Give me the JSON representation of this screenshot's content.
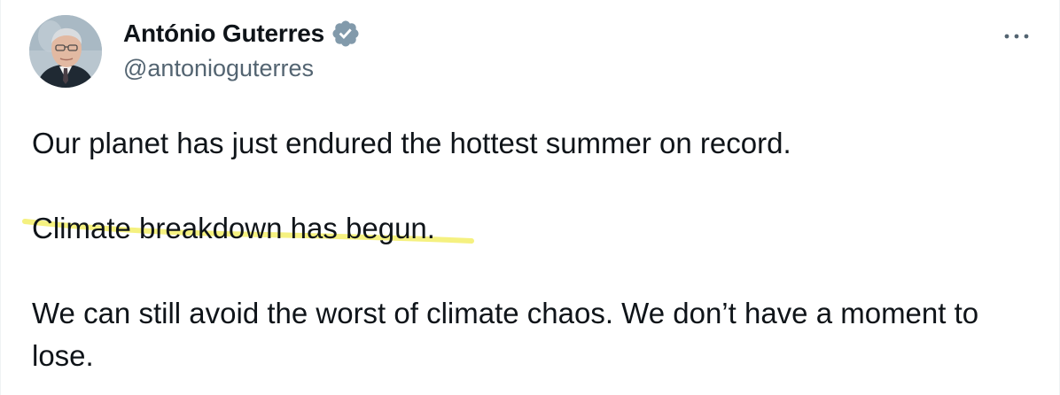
{
  "author": {
    "display_name": "António Guterres",
    "handle": "@antonioguterres",
    "verified_badge_icon": "verified-badge-icon",
    "verified_color": "#829aab"
  },
  "more_menu_icon": "more-horizontal-icon",
  "tweet": {
    "paragraph_1": "Our planet has just endured the hottest summer on record.",
    "paragraph_2": "Climate breakdown has begun.",
    "paragraph_3": "We can still avoid the worst of climate chaos. We don’t have a moment to lose."
  },
  "colors": {
    "text": "#0f1419",
    "secondary_text": "#536471",
    "highlighter": "#f3ef6a"
  }
}
